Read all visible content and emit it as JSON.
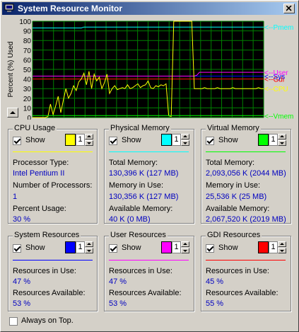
{
  "window": {
    "title": "System Resource Monitor"
  },
  "chart_data": {
    "type": "line",
    "title": "",
    "xlabel": "",
    "ylabel": "Percent (%) Used",
    "ylim": [
      0,
      100
    ],
    "yticks": [
      "0",
      "10",
      "20",
      "30",
      "40",
      "50",
      "60",
      "70",
      "80",
      "90",
      "100"
    ],
    "grid": true,
    "x": [
      0,
      1,
      2,
      3,
      4,
      5,
      6,
      7,
      8,
      9,
      10,
      11,
      12,
      13,
      14,
      15,
      16,
      17,
      18,
      19,
      20,
      21,
      22,
      23,
      24,
      25,
      26,
      27,
      28,
      29,
      30,
      31,
      32,
      33,
      34,
      35,
      36,
      37,
      38,
      39,
      40,
      41,
      42,
      43,
      44,
      45,
      46,
      47,
      48,
      49,
      50,
      51,
      52,
      53,
      54,
      55,
      56,
      57,
      58,
      59,
      60,
      61,
      62,
      63,
      64,
      65,
      66,
      67,
      68,
      69,
      70,
      71,
      72,
      73,
      74,
      75,
      76,
      77,
      78,
      79,
      80,
      81,
      82,
      83,
      84,
      85,
      86,
      87,
      88,
      89,
      90
    ],
    "series": [
      {
        "name": "Pmem",
        "color": "#00ffff",
        "values": [
          93,
          93,
          93,
          93,
          93,
          93,
          93,
          93,
          93,
          93,
          93,
          93,
          93,
          93,
          93,
          93,
          93,
          93,
          93,
          93,
          94,
          94,
          94,
          94,
          94,
          94,
          94,
          94,
          94,
          94,
          94,
          94,
          94,
          94,
          94,
          94,
          94,
          94,
          94,
          94,
          94,
          94,
          94,
          94,
          94,
          94,
          94,
          94,
          94,
          94,
          94,
          94,
          94,
          94,
          94,
          94,
          94,
          94,
          94,
          94,
          94,
          94,
          94,
          94,
          94,
          94,
          94,
          94,
          94,
          94,
          94,
          94,
          94,
          94,
          94,
          94,
          94,
          94,
          94,
          94,
          94,
          94,
          94,
          94,
          94,
          94,
          94,
          94,
          94,
          94,
          94
        ]
      },
      {
        "name": "Gdi",
        "color": "#ff0000",
        "values": [
          40,
          40,
          40,
          40,
          40,
          40,
          40,
          40,
          40,
          40,
          40,
          40,
          40,
          40,
          40,
          40,
          40,
          40,
          40,
          40,
          40,
          40,
          40,
          40,
          40,
          40,
          40,
          40,
          40,
          40,
          40,
          40,
          40,
          40,
          40,
          40,
          40,
          40,
          40,
          40,
          40,
          40,
          40,
          40,
          40,
          40,
          40,
          40,
          40,
          40,
          40,
          40,
          40,
          40,
          40,
          40,
          40,
          40,
          40,
          40,
          40,
          40,
          40,
          40,
          40,
          40,
          40,
          40,
          40,
          40,
          40,
          40,
          40,
          40,
          40,
          40,
          40,
          40,
          40,
          40,
          40,
          40,
          40,
          40,
          40,
          40,
          40,
          40,
          40,
          40,
          40
        ]
      },
      {
        "name": "Sys",
        "color": "#0000ff",
        "values": [
          43,
          43,
          43,
          43,
          43,
          43,
          43,
          43,
          43,
          43,
          43,
          43,
          43,
          43,
          43,
          43,
          43,
          43,
          43,
          43,
          43,
          43,
          43,
          43,
          43,
          43,
          43,
          43,
          43,
          43,
          43,
          43,
          43,
          43,
          43,
          43,
          43,
          43,
          43,
          43,
          43,
          43,
          43,
          43,
          43,
          43,
          43,
          43,
          43,
          43,
          43,
          43,
          43,
          43,
          43,
          43,
          43,
          43,
          43,
          43,
          43,
          43,
          43,
          43,
          43,
          43,
          43,
          43,
          43,
          43,
          43,
          43,
          43,
          43,
          43,
          43,
          43,
          43,
          43,
          43,
          43,
          43,
          43,
          43,
          43,
          43,
          43,
          43,
          43,
          43,
          43
        ]
      },
      {
        "name": "User",
        "color": "#ff00ff",
        "values": [
          43,
          43,
          43,
          43,
          43,
          43,
          43,
          43,
          43,
          43,
          43,
          43,
          43,
          43,
          43,
          43,
          43,
          43,
          43,
          43,
          43,
          43,
          43,
          43,
          43,
          43,
          43,
          43,
          43,
          43,
          43,
          43,
          43,
          43,
          43,
          43,
          43,
          43,
          43,
          43,
          43,
          43,
          43,
          43,
          43,
          43,
          43,
          43,
          43,
          43,
          43,
          43,
          43,
          43,
          43,
          43,
          43,
          43,
          43,
          43,
          43,
          43,
          43,
          43,
          44,
          47,
          47,
          47,
          47,
          47,
          47,
          47,
          47,
          47,
          47,
          47,
          47,
          47,
          47,
          47,
          47,
          47,
          47,
          47,
          47,
          47,
          47,
          47,
          47,
          47,
          47
        ]
      },
      {
        "name": "CPU",
        "color": "#ffff00",
        "values": [
          0,
          0,
          0,
          0,
          0,
          0,
          1,
          14,
          3,
          12,
          22,
          5,
          18,
          30,
          20,
          25,
          33,
          28,
          37,
          40,
          46,
          34,
          48,
          30,
          45,
          38,
          42,
          30,
          36,
          45,
          25,
          30,
          33,
          29,
          30,
          31,
          30,
          34,
          30,
          31,
          33,
          35,
          31,
          33,
          34,
          38,
          31,
          30,
          33,
          32,
          34,
          33,
          35,
          2,
          1,
          100,
          100,
          100,
          100,
          100,
          100,
          100,
          100,
          30,
          30,
          30,
          30,
          31,
          30,
          30,
          30,
          30,
          31,
          30,
          30,
          30,
          30,
          30,
          31,
          30,
          30,
          30,
          30,
          30,
          30,
          30,
          30,
          30,
          31,
          30,
          30
        ]
      },
      {
        "name": "Vmem",
        "color": "#00ff00",
        "values": [
          2,
          2,
          2,
          2,
          2,
          2,
          2,
          2,
          2,
          2,
          2,
          2,
          2,
          2,
          2,
          2,
          2,
          2,
          2,
          2,
          2,
          2,
          2,
          2,
          2,
          2,
          2,
          2,
          2,
          2,
          2,
          2,
          2,
          2,
          2,
          2,
          2,
          2,
          2,
          2,
          2,
          2,
          2,
          2,
          2,
          2,
          2,
          2,
          2,
          2,
          2,
          2,
          2,
          2,
          2,
          2,
          2,
          2,
          2,
          2,
          2,
          2,
          2,
          2,
          2,
          2,
          2,
          2,
          2,
          2,
          2,
          2,
          2,
          2,
          2,
          2,
          2,
          2,
          2,
          2,
          2,
          2,
          2,
          2,
          2,
          2,
          2,
          2,
          2,
          2,
          2
        ]
      }
    ],
    "legend_labels": [
      {
        "text": "<--Pmem",
        "color": "#00ffff"
      },
      {
        "text": "<--Gdi",
        "color": "#ff0000"
      },
      {
        "text": "<--Sys",
        "color": "#0000ff"
      },
      {
        "text": "<--User",
        "color": "#ff00ff"
      },
      {
        "text": "<--CPU",
        "color": "#ffff00"
      },
      {
        "text": "<--Vmem",
        "color": "#00ff00"
      }
    ]
  },
  "groups": {
    "cpu": {
      "title": "CPU Usage",
      "show": "Show",
      "color": "#ffff00",
      "spin": "1",
      "l1": "Processor Type:",
      "v1": "Intel Pentium II",
      "l2": "Number of Processors:",
      "v2": "1",
      "l3": "Percent Usage:",
      "v3": "30 %"
    },
    "pmem": {
      "title": "Physical Memory",
      "show": "Show",
      "color": "#00ffff",
      "spin": "1",
      "l1": "Total Memory:",
      "v1": "130,396 K (127 MB)",
      "l2": "Memory in Use:",
      "v2": "130,356 K (127 MB)",
      "l3": "Available  Memory:",
      "v3": "40 K (0 MB)"
    },
    "vmem": {
      "title": "Virtual Memory",
      "show": "Show",
      "color": "#00ff00",
      "spin": "1",
      "l1": "Total Memory:",
      "v1": "2,093,056 K (2044 MB)",
      "l2": "Memory in Use:",
      "v2": "25,536 K (25 MB)",
      "l3": "Available Memory:",
      "v3": "2,067,520 K (2019 MB)"
    },
    "sys": {
      "title": "System Resources",
      "show": "Show",
      "color": "#0000ff",
      "spin": "1",
      "l1": "Resources in Use:",
      "v1": "47 %",
      "l2": "Resources Available:",
      "v2": "53 %"
    },
    "user": {
      "title": "User Resources",
      "show": "Show",
      "color": "#ff00ff",
      "spin": "1",
      "l1": "Resources in Use:",
      "v1": "47 %",
      "l2": "Resources Available:",
      "v2": "53 %"
    },
    "gdi": {
      "title": "GDI Resources",
      "show": "Show",
      "color": "#ff0000",
      "spin": "1",
      "l1": "Resources in Use:",
      "v1": "45 %",
      "l2": "Resources Available:",
      "v2": "55 %"
    }
  },
  "footer": {
    "always_on_top": "Always on Top."
  }
}
